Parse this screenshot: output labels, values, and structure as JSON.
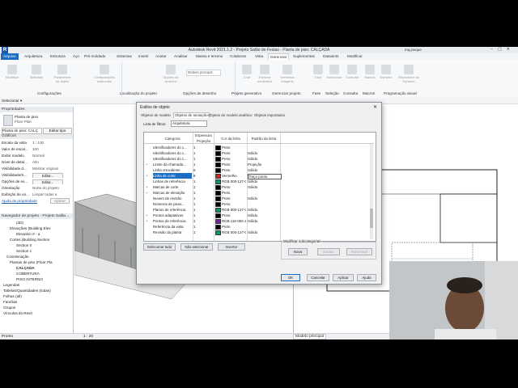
{
  "titlebar": {
    "title": "Autodesk Revit 2021.1.2 - Projeto Salão de Festas - Planta de piso: CALÇADA",
    "user": "mq.josque"
  },
  "menu": {
    "arquivo": "Arquivo",
    "tabs": [
      "Arquitetura",
      "Estrutura",
      "Aço",
      "Pré-moldado",
      "Sistemas",
      "Inserir",
      "Anotar",
      "Analisar",
      "Massa e terreno",
      "Colaborar",
      "Vista",
      "Gerenciar",
      "Suplementos",
      "Dataoints",
      "Modificar"
    ],
    "active_tab": "Gerenciar"
  },
  "ribbon": {
    "buttons": [
      "Modificar",
      "Materiais",
      "Parâmetros do objeto",
      "Configurações adicionais",
      "Opções de desenho",
      "Modelo principal",
      "Criar",
      "Explorar resultados",
      "Gerenciar imagens",
      "Fase",
      "Selecionar",
      "Consulta",
      "Macros",
      "Dynamo",
      "Reprodutor do Dynamo"
    ],
    "groups": [
      "Configurações",
      "Localização do projeto",
      "Opções de desenho",
      "Projeto generativo",
      "Gerenciar projeto",
      "Fase",
      "Seleção",
      "Consulta",
      "Macros",
      "Programação visual"
    ],
    "modelo_principal": "Modelo principal"
  },
  "selbar": {
    "label": "Selecionar ▾"
  },
  "properties": {
    "header": "Propriedades",
    "type_line1": "Planta de piso",
    "type_line2": "Floor Plan",
    "selector": "Planta de piso: CALÇ",
    "edit_type": "Editar tipo",
    "section": "Gráficos",
    "rows": [
      {
        "k": "Escala da vista",
        "v": "1 : 100"
      },
      {
        "k": "Valor de escal...",
        "v": "100"
      },
      {
        "k": "Exibir modelo",
        "v": "Normal"
      },
      {
        "k": "Nível de detal...",
        "v": "Alto"
      },
      {
        "k": "Visibilidade d...",
        "v": "Mostrar original"
      },
      {
        "k": "Visibilidade/S...",
        "v": "Editar..."
      },
      {
        "k": "Opções de ex...",
        "v": "Editar..."
      },
      {
        "k": "Orientação",
        "v": "Norte do projeto"
      },
      {
        "k": "Exibição de un...",
        "v": "Limpar todas a"
      }
    ],
    "help_link": "Ajuda de propriedades",
    "apply": "Aplicar"
  },
  "browser": {
    "header": "Navegador de projeto - Projeto Salão...",
    "nodes": [
      {
        "text": "(3D)",
        "indent": 4
      },
      {
        "text": "Elevações (Building Elev",
        "indent": 2
      },
      {
        "text": "Elevation 0 - a",
        "indent": 4
      },
      {
        "text": "Cortes (Building Section",
        "indent": 2
      },
      {
        "text": "Section 0",
        "indent": 4
      },
      {
        "text": "Section 1",
        "indent": 4
      },
      {
        "text": "Coordenação",
        "indent": 1
      },
      {
        "text": "Plantas de piso (Floor Pla",
        "indent": 2
      },
      {
        "text": "CALÇADA",
        "indent": 4,
        "bold": true
      },
      {
        "text": "COBERTURA",
        "indent": 4
      },
      {
        "text": "PISO INTERNO",
        "indent": 4
      },
      {
        "text": "Legendas",
        "indent": 0
      },
      {
        "text": "Tabelas/Quantidades (todas)",
        "indent": 0
      },
      {
        "text": "Folhas (all)",
        "indent": 0
      },
      {
        "text": "Famílias",
        "indent": 0
      },
      {
        "text": "Grupos",
        "indent": 0
      },
      {
        "text": "Vínculos do Revit",
        "indent": 0
      }
    ]
  },
  "dialog": {
    "title": "Estilos de objeto",
    "tabs": [
      "Objetos de modelo",
      "Objetos de anotação",
      "Objetos do modelo analítico",
      "Objetos importados"
    ],
    "active_tab": "Objetos de anotação",
    "filter_label": "Lista de filtros:",
    "filter_value": "Arquitetura",
    "columns": {
      "category": "Categoria",
      "espessura": "Espessura",
      "projecao": "Projeção",
      "cor": "Cor da linha",
      "padrao": "Padrão da linha"
    },
    "rows": [
      {
        "exp": "",
        "cat": "Identificadores do c...",
        "esp": "1",
        "cor": "Preto",
        "swatch": "#000000",
        "pad": ""
      },
      {
        "exp": "",
        "cat": "Identificadores do c...",
        "esp": "1",
        "cor": "Preto",
        "swatch": "#000000",
        "pad": "Sólido"
      },
      {
        "exp": "",
        "cat": "Identificadores do c...",
        "esp": "1",
        "cor": "Preto",
        "swatch": "#000000",
        "pad": "Sólido"
      },
      {
        "exp": "+",
        "cat": "Limite da chamada...",
        "esp": "1",
        "cor": "Preto",
        "swatch": "#000000",
        "pad": "Projeção"
      },
      {
        "exp": "",
        "cat": "Linha ortovidente",
        "esp": "6",
        "cor": "Preto",
        "swatch": "#000000",
        "pad": "Sólido"
      },
      {
        "exp": "+",
        "cat": "Linha de corte",
        "esp": "8",
        "cor": "Vermelho",
        "swatch": "#e02020",
        "pad": "Traço ponto",
        "highlight": true
      },
      {
        "exp": "",
        "cat": "Linhas de referência",
        "esp": "1",
        "cor": "RGB 000-127-C",
        "swatch": "#00a060",
        "pad": "Sólido"
      },
      {
        "exp": "+",
        "cat": "Marcas de corte",
        "esp": "1",
        "cor": "Preto",
        "swatch": "#000000",
        "pad": "Sólido"
      },
      {
        "exp": "+",
        "cat": "Marcas de elevação",
        "esp": "1",
        "cor": "Preto",
        "swatch": "#000000",
        "pad": ""
      },
      {
        "exp": "",
        "cat": "Nuvem de revisão",
        "esp": "1",
        "cor": "Preto",
        "swatch": "#000000",
        "pad": "Sólido"
      },
      {
        "exp": "",
        "cat": "Números de pisos...",
        "esp": "1",
        "cor": "Preto",
        "swatch": "#000000",
        "pad": ""
      },
      {
        "exp": "",
        "cat": "Planos de referência",
        "esp": "1",
        "cor": "RGB 000-127-C",
        "swatch": "#00a060",
        "pad": "Sólido"
      },
      {
        "exp": "+",
        "cat": "Pontos adaptativos",
        "esp": "1",
        "cor": "Preto",
        "swatch": "#000000",
        "pad": "Sólido"
      },
      {
        "exp": "+",
        "cat": "Pontos de referência",
        "esp": "1",
        "cor": "RGB 119-050-1",
        "swatch": "#7a1fa0",
        "pad": "Sólido"
      },
      {
        "exp": "",
        "cat": "Referência da vista",
        "esp": "1",
        "cor": "Preto",
        "swatch": "#000000",
        "pad": ""
      },
      {
        "exp": "",
        "cat": "Revisão da planta",
        "esp": "1",
        "cor": "RGB 000-127-C",
        "swatch": "#00a060",
        "pad": "Sólido"
      }
    ],
    "btn_select_all": "Selecionar tudo",
    "btn_select_none": "Não selecionar",
    "btn_invert": "Inverter",
    "subcat_title": "Modificar subcategorias",
    "btn_new": "Nova",
    "btn_delete": "Excluir",
    "btn_rename": "Renomear",
    "btn_ok": "OK",
    "btn_cancel": "Cancelar",
    "btn_apply": "Aplicar",
    "btn_help": "Ajuda"
  },
  "status": {
    "left": "Pronto",
    "scale_a": "1 : 20",
    "scale_b": "1 : 100",
    "model": "Modelo principal"
  },
  "colors": {
    "accent": "#1b6ec2",
    "revit_blue": "#1b5aa6"
  }
}
